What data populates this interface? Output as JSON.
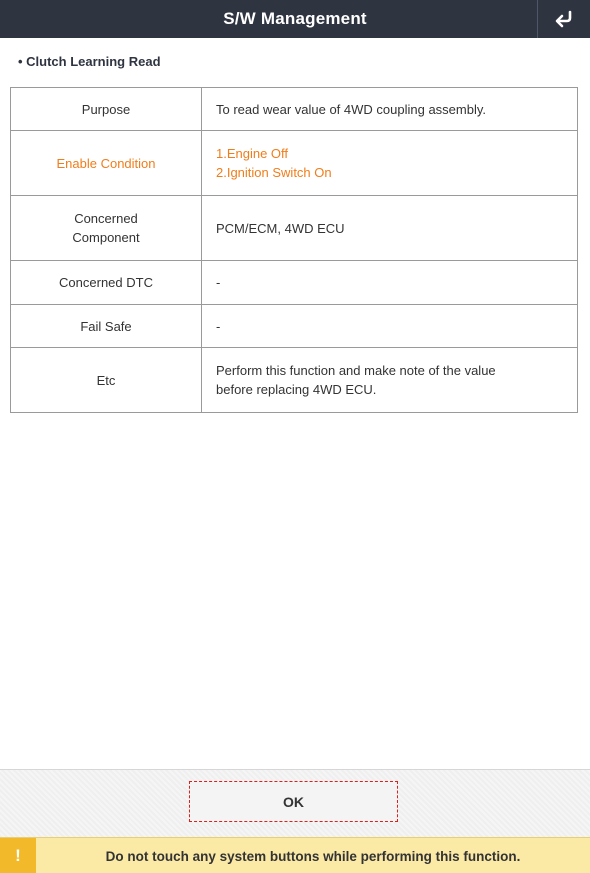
{
  "header": {
    "title": "S/W Management",
    "back_icon": "return-arrow-icon"
  },
  "section": {
    "label": "• Clutch Learning Read"
  },
  "table": {
    "rows": [
      {
        "label": "Purpose",
        "value_lines": [
          "To read wear value of 4WD coupling assembly."
        ]
      },
      {
        "label": "Enable Condition",
        "value_lines": [
          "1.Engine Off",
          "2.Ignition Switch On"
        ],
        "highlight": true
      },
      {
        "label_lines": [
          "Concerned",
          "Component"
        ],
        "value_lines": [
          "PCM/ECM, 4WD ECU"
        ]
      },
      {
        "label": "Concerned DTC",
        "value_lines": [
          "-"
        ]
      },
      {
        "label": "Fail Safe",
        "value_lines": [
          "-"
        ]
      },
      {
        "label": "Etc",
        "value_lines": [
          "Perform this function and make note of the value",
          "before replacing 4WD ECU."
        ]
      }
    ]
  },
  "buttons": {
    "ok_label": "OK"
  },
  "warning": {
    "icon_glyph": "!",
    "icon": "warning-icon",
    "text": "Do not touch any system buttons while performing this function."
  },
  "colors": {
    "titlebar": "#2f3441",
    "highlight": "#f07d1b",
    "warning_bg": "#fbe9a6",
    "warning_icon_bg": "#f2b92b",
    "focus_border": "#d9211e"
  }
}
